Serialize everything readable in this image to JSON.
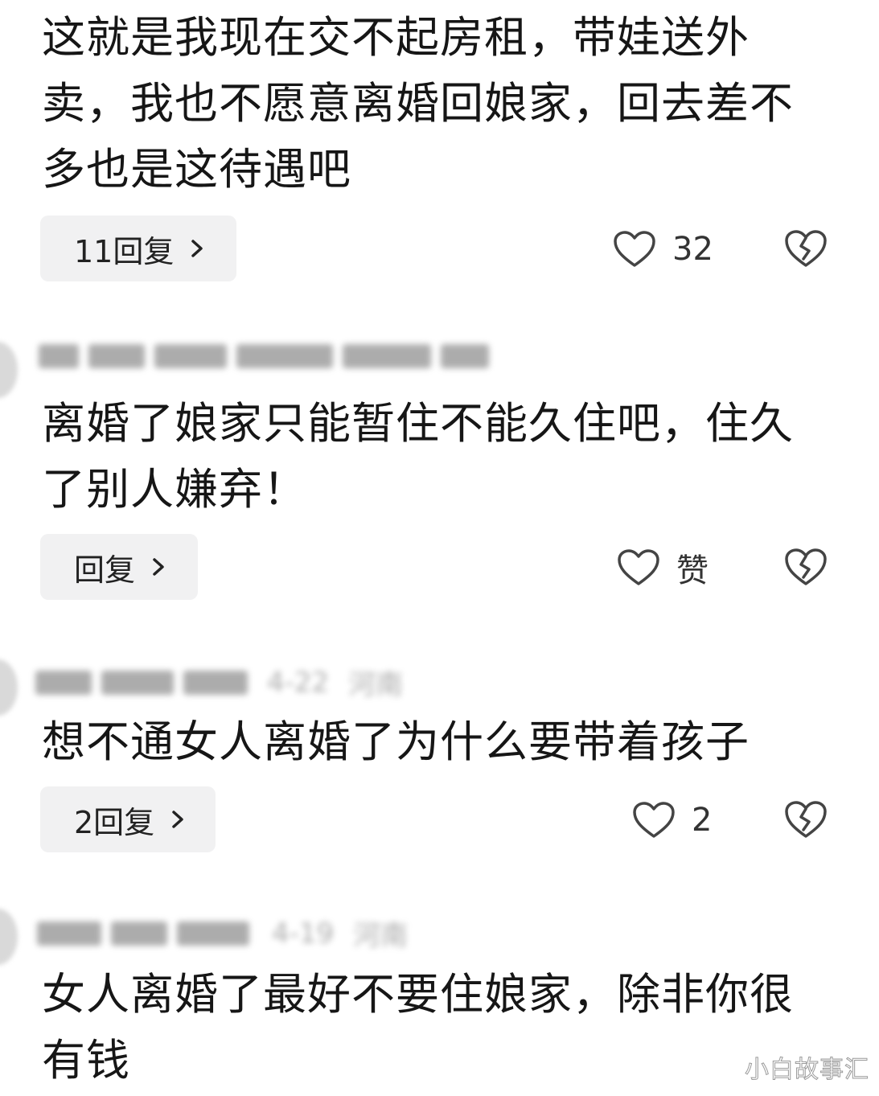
{
  "comments": [
    {
      "text": "这就是我现在交不起房租，带娃送外\n卖，我也不愿意离婚回娘家，回去差不\n多也是这待遇吧",
      "reply_label": "11回复",
      "like_label": "32"
    },
    {
      "text": "离婚了娘家只能暂住不能久住吧，住久\n了别人嫌弃！",
      "reply_label": "回复",
      "like_label": "赞"
    },
    {
      "date": "4-22",
      "location": "河南",
      "text": "想不通女人离婚了为什么要带着孩子",
      "reply_label": "2回复",
      "like_label": "2"
    },
    {
      "date": "4-19",
      "location": "河南",
      "text": "女人离婚了最好不要住娘家，除非你很\n有钱"
    }
  ],
  "watermark": "小白故事汇",
  "icons": {
    "like": "heart-outline-icon",
    "dislike": "broken-heart-icon",
    "chevron": "chevron-right-icon"
  },
  "colors": {
    "text": "#161616",
    "reply_bg": "#f1f1f2",
    "icon_stroke": "#444444"
  }
}
